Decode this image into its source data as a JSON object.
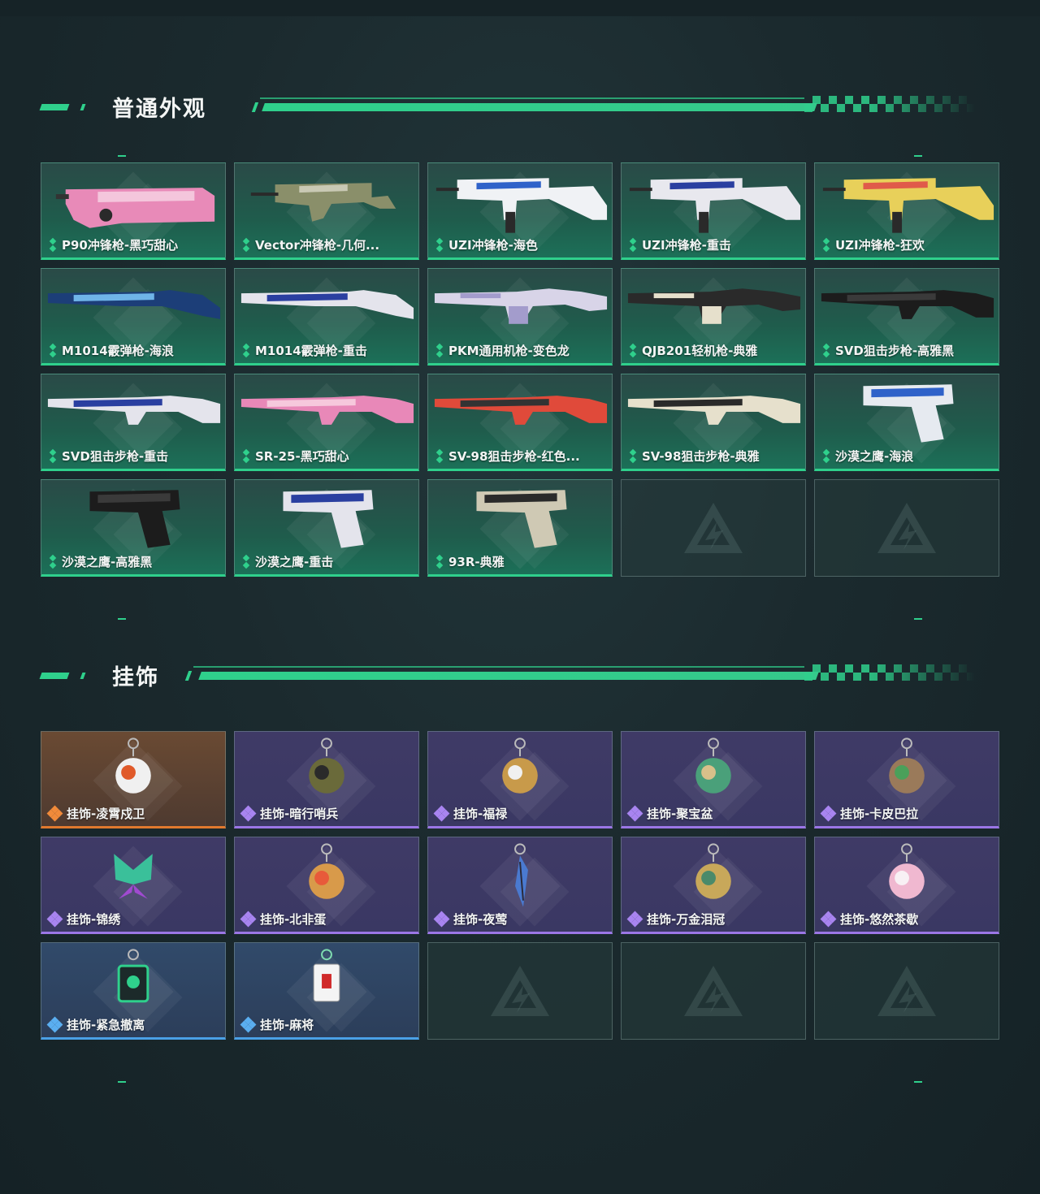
{
  "sections": [
    {
      "title": "普通外观",
      "items": [
        {
          "label": "P90冲锋枪-黑巧甜心",
          "tier": "green",
          "art": "p90",
          "colors": [
            "#e88ab8",
            "#f4c6dc"
          ]
        },
        {
          "label": "Vector冲锋枪-几何...",
          "tier": "green",
          "art": "vector",
          "colors": [
            "#8a8f6a",
            "#c9c9b4"
          ]
        },
        {
          "label": "UZI冲锋枪-海色",
          "tier": "green",
          "art": "uzi",
          "colors": [
            "#f0f2f5",
            "#2f62c9"
          ]
        },
        {
          "label": "UZI冲锋枪-重击",
          "tier": "green",
          "art": "uzi",
          "colors": [
            "#e8e8ee",
            "#2a3fa0"
          ]
        },
        {
          "label": "UZI冲锋枪-狂欢",
          "tier": "green",
          "art": "uzi",
          "colors": [
            "#e8d05a",
            "#e05a4a"
          ]
        },
        {
          "label": "M1014霰弹枪-海浪",
          "tier": "green",
          "art": "shotgun",
          "colors": [
            "#1c3e78",
            "#6fb4e8"
          ]
        },
        {
          "label": "M1014霰弹枪-重击",
          "tier": "green",
          "art": "shotgun",
          "colors": [
            "#e4e4ec",
            "#2a3fa0"
          ]
        },
        {
          "label": "PKM通用机枪-变色龙",
          "tier": "green",
          "art": "mg",
          "colors": [
            "#d8d4e8",
            "#a39ccc"
          ]
        },
        {
          "label": "QJB201轻机枪-典雅",
          "tier": "green",
          "art": "mg",
          "colors": [
            "#2a2a2a",
            "#e6e0cc"
          ]
        },
        {
          "label": "SVD狙击步枪-高雅黑",
          "tier": "green",
          "art": "rifle",
          "colors": [
            "#1c1c1c",
            "#3a3a3a"
          ]
        },
        {
          "label": "SVD狙击步枪-重击",
          "tier": "green",
          "art": "rifle",
          "colors": [
            "#e4e4ec",
            "#2a3fa0"
          ]
        },
        {
          "label": "SR-25-黑巧甜心",
          "tier": "green",
          "art": "rifle",
          "colors": [
            "#e888b8",
            "#f6c8dc"
          ]
        },
        {
          "label": "SV-98狙击步枪-红色...",
          "tier": "green",
          "art": "rifle",
          "colors": [
            "#e04a3a",
            "#333333"
          ]
        },
        {
          "label": "SV-98狙击步枪-典雅",
          "tier": "green",
          "art": "rifle",
          "colors": [
            "#e6e0cc",
            "#2a2a2a"
          ]
        },
        {
          "label": "沙漠之鹰-海浪",
          "tier": "green",
          "art": "pistol",
          "colors": [
            "#e6eaf0",
            "#2f62c9"
          ]
        },
        {
          "label": "沙漠之鹰-高雅黑",
          "tier": "green",
          "art": "pistol",
          "colors": [
            "#1c1c1c",
            "#3a3a3a"
          ]
        },
        {
          "label": "沙漠之鹰-重击",
          "tier": "green",
          "art": "pistol",
          "colors": [
            "#e4e4ec",
            "#2a3fa0"
          ]
        },
        {
          "label": "93R-典雅",
          "tier": "green",
          "art": "pistol",
          "colors": [
            "#cfc9b4",
            "#2a2a2a"
          ]
        },
        {
          "label": "",
          "tier": "empty"
        },
        {
          "label": "",
          "tier": "empty"
        }
      ]
    },
    {
      "title": "挂饰",
      "items": [
        {
          "label": "挂饰-凌霄戍卫",
          "tier": "orange",
          "art": "charm",
          "colors": [
            "#f0f0f0",
            "#e05a2a"
          ]
        },
        {
          "label": "挂饰-暗行哨兵",
          "tier": "purple",
          "art": "charm",
          "colors": [
            "#6a6a3a",
            "#2a2a2a"
          ]
        },
        {
          "label": "挂饰-福禄",
          "tier": "purple",
          "art": "charm",
          "colors": [
            "#c89a4a",
            "#f0f0f0"
          ]
        },
        {
          "label": "挂饰-聚宝盆",
          "tier": "purple",
          "art": "charm",
          "colors": [
            "#4aa07a",
            "#d8c08a"
          ]
        },
        {
          "label": "挂饰-卡皮巴拉",
          "tier": "purple",
          "art": "charm",
          "colors": [
            "#9a7a5a",
            "#4aa05a"
          ]
        },
        {
          "label": "挂饰-锦绣",
          "tier": "purple",
          "art": "butterfly",
          "colors": [
            "#3ac09a",
            "#a04ad0"
          ]
        },
        {
          "label": "挂饰-北非蛋",
          "tier": "purple",
          "art": "charm",
          "colors": [
            "#d89a4a",
            "#e85a3a"
          ]
        },
        {
          "label": "挂饰-夜莺",
          "tier": "purple",
          "art": "feather",
          "colors": [
            "#4a7ad0",
            "#2a2a3a"
          ]
        },
        {
          "label": "挂饰-万金泪冠",
          "tier": "purple",
          "art": "charm",
          "colors": [
            "#c8a85a",
            "#4a8a6a"
          ]
        },
        {
          "label": "挂饰-悠然茶歇",
          "tier": "purple",
          "art": "charm",
          "colors": [
            "#f0b8d0",
            "#f8f0f4"
          ]
        },
        {
          "label": "挂饰-紧急撤离",
          "tier": "blue",
          "art": "tag",
          "colors": [
            "#2fd08c",
            "#1c2a2a"
          ]
        },
        {
          "label": "挂饰-麻将",
          "tier": "blue",
          "art": "tile",
          "colors": [
            "#f4f4f4",
            "#d02a2a"
          ]
        },
        {
          "label": "",
          "tier": "empty"
        },
        {
          "label": "",
          "tier": "empty"
        },
        {
          "label": "",
          "tier": "empty"
        }
      ]
    }
  ]
}
